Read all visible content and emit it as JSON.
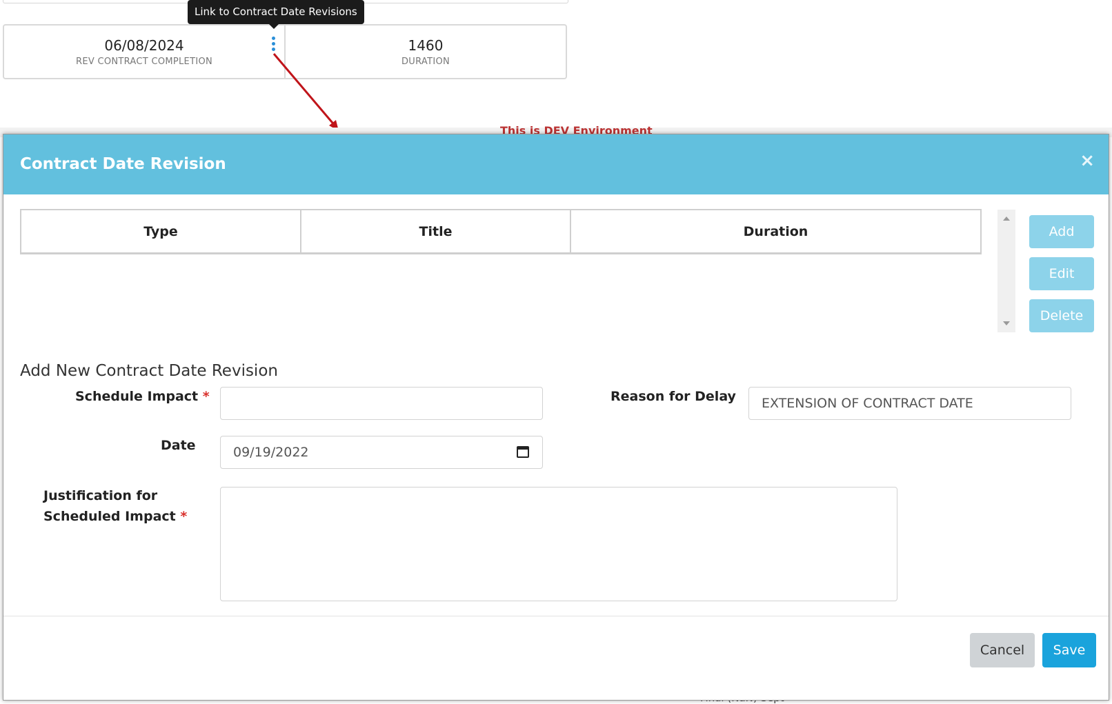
{
  "tooltip": {
    "text": "Link to Contract Date Revisions"
  },
  "summary": {
    "rev_contract_completion": {
      "value": "06/08/2024",
      "label": "REV CONTRACT COMPLETION"
    },
    "duration": {
      "value": "1460",
      "label": "DURATION"
    }
  },
  "background": {
    "environment_banner": "This is DEV Environment",
    "footer_text": "Final (NaN)  Sept"
  },
  "modal": {
    "title": "Contract Date Revision",
    "close_icon": "×",
    "grid": {
      "columns": [
        "Type",
        "Title",
        "Duration"
      ]
    },
    "actions": {
      "add": "Add",
      "edit": "Edit",
      "delete": "Delete"
    },
    "form": {
      "section_title": "Add New Contract Date Revision",
      "schedule_impact": {
        "label": "Schedule Impact",
        "required_marker": "*",
        "value": ""
      },
      "reason_for_delay": {
        "label": "Reason for Delay",
        "value": "EXTENSION OF CONTRACT DATE"
      },
      "date": {
        "label": "Date",
        "value": "09/19/2022"
      },
      "justification": {
        "label_line1": "Justification for",
        "label_line2": "Scheduled Impact",
        "required_marker": "*",
        "value": ""
      }
    },
    "footer": {
      "cancel": "Cancel",
      "save": "Save"
    }
  },
  "colors": {
    "header": "#62c0de",
    "save": "#1aa3dc",
    "side_buttons": "#8dd3ea",
    "required": "#d9302c",
    "arrow": "#c0141a"
  }
}
